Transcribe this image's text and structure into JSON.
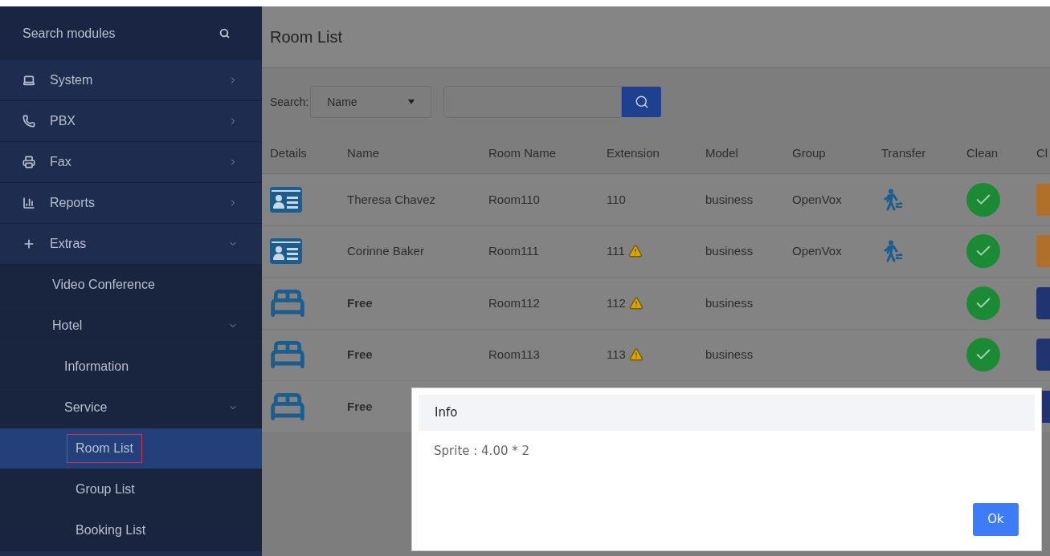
{
  "sidebar": {
    "search": {
      "placeholder": "Search modules"
    },
    "items": [
      {
        "label": "System",
        "expanded": false,
        "selected": false
      },
      {
        "label": "PBX",
        "expanded": false,
        "selected": false
      },
      {
        "label": "Fax",
        "expanded": false,
        "selected": false
      },
      {
        "label": "Reports",
        "expanded": false,
        "selected": false
      },
      {
        "label": "Extras",
        "expanded": true,
        "selected": false,
        "children": [
          {
            "label": "Video Conference",
            "selected": false
          },
          {
            "label": "Hotel",
            "expanded": true,
            "selected": false,
            "children": [
              {
                "label": "Information",
                "selected": false
              },
              {
                "label": "Service",
                "expanded": true,
                "selected": false,
                "children": [
                  {
                    "label": "Room List",
                    "selected": true
                  },
                  {
                    "label": "Group List",
                    "selected": false
                  },
                  {
                    "label": "Booking List",
                    "selected": false
                  }
                ]
              }
            ]
          }
        ]
      }
    ]
  },
  "page": {
    "title": "Room List"
  },
  "search": {
    "label": "Search:",
    "field": "Name"
  },
  "table": {
    "columns": [
      "Details",
      "Name",
      "Room Name",
      "Extension",
      "Model",
      "Group",
      "Transfer",
      "Clean",
      "Cl"
    ],
    "rows": [
      {
        "kind": "card",
        "name": "Theresa Chavez",
        "room_name": "Room110",
        "extension": "110",
        "warning": false,
        "model": "business",
        "group": "OpenVox",
        "transfer": true,
        "clean": true,
        "color": "#b0702a"
      },
      {
        "kind": "card",
        "name": "Corinne Baker",
        "room_name": "Room111",
        "extension": "111",
        "warning": true,
        "model": "business",
        "group": "OpenVox",
        "transfer": true,
        "clean": true,
        "color": "#b0702a"
      },
      {
        "kind": "bed",
        "name": "Free",
        "room_name": "Room112",
        "extension": "112",
        "warning": true,
        "model": "business",
        "transfer": false,
        "clean": true,
        "color": "#1f3470"
      },
      {
        "kind": "bed",
        "name": "Free",
        "room_name": "Room113",
        "extension": "113",
        "warning": true,
        "model": "business",
        "transfer": false,
        "clean": true,
        "color": "#1f3470"
      },
      {
        "kind": "bed",
        "name": "Free",
        "color": "#1f3470"
      }
    ]
  },
  "dialog": {
    "title": "Info",
    "message": "Sprite : 4.00 * 2",
    "buttons": [
      "Ok"
    ]
  }
}
